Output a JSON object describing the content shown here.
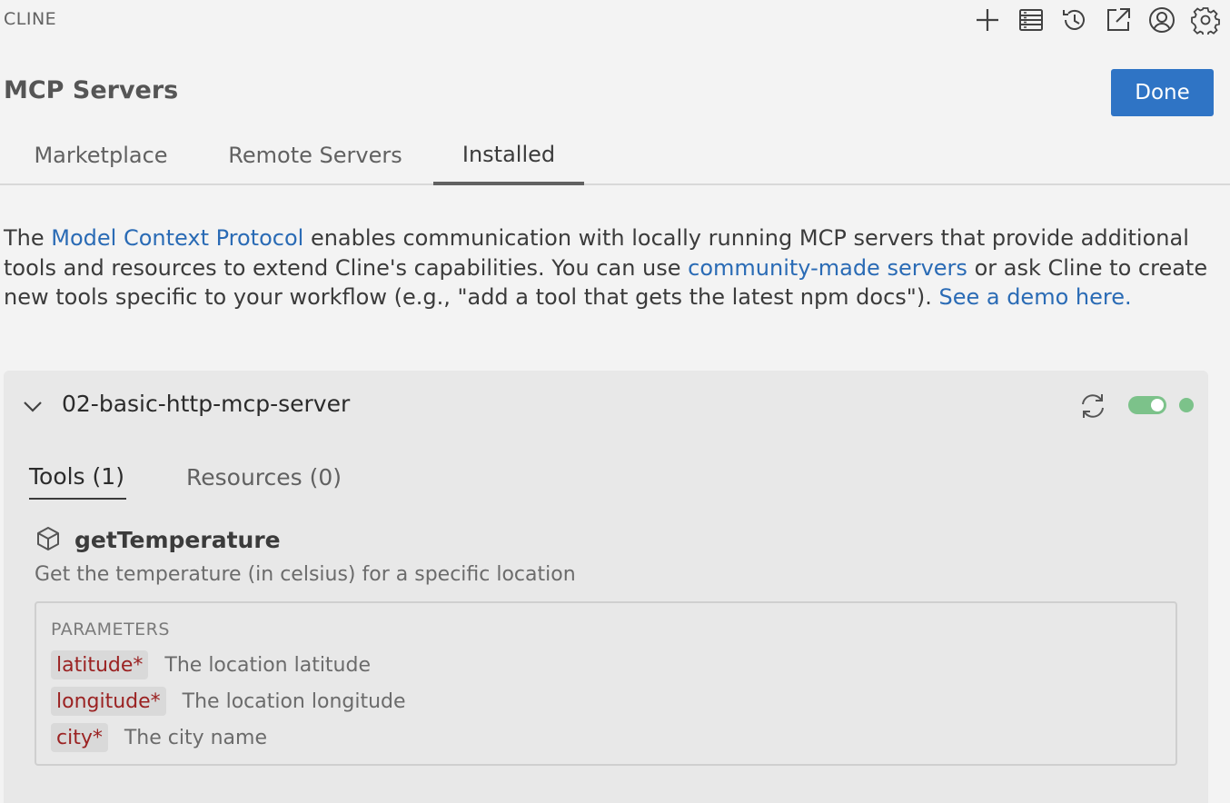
{
  "app": {
    "title": "CLINE"
  },
  "toolbar": {
    "icons": [
      "plus-icon",
      "server-icon",
      "history-icon",
      "popout-icon",
      "account-icon",
      "settings-icon"
    ]
  },
  "header": {
    "title": "MCP Servers",
    "done_label": "Done"
  },
  "tabs": [
    {
      "label": "Marketplace",
      "active": false
    },
    {
      "label": "Remote Servers",
      "active": false
    },
    {
      "label": "Installed",
      "active": true
    }
  ],
  "intro": {
    "t1": "The ",
    "link1": "Model Context Protocol",
    "t2": " enables communication with locally running MCP servers that provide additional tools and resources to extend Cline's capabilities. You can use ",
    "link2": "community-made servers",
    "t3": " or ask Cline to create new tools specific to your workflow (e.g., \"add a tool that gets the latest npm docs\"). ",
    "link3": "See a demo here."
  },
  "server": {
    "name": "02-basic-http-mcp-server",
    "enabled": true,
    "status_color": "#7cc28a",
    "sub_tabs": [
      {
        "label": "Tools (1)",
        "active": true
      },
      {
        "label": "Resources (0)",
        "active": false
      }
    ],
    "tool": {
      "name": "getTemperature",
      "description": "Get the temperature (in celsius) for a specific location",
      "params_title": "PARAMETERS",
      "params": [
        {
          "name": "latitude*",
          "desc": "The location latitude"
        },
        {
          "name": "longitude*",
          "desc": "The location longitude"
        },
        {
          "name": "city*",
          "desc": "The city name"
        }
      ]
    }
  },
  "colors": {
    "accent": "#2f74c5",
    "link": "#2a6bb5",
    "param": "#9b2222"
  }
}
